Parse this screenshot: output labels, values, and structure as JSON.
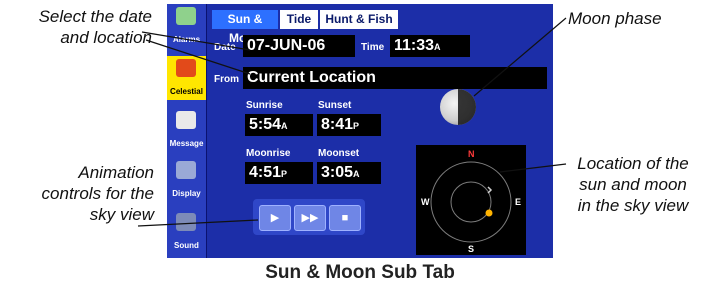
{
  "callouts": {
    "select_date_location_line1": "Select the date",
    "select_date_location_line2": "and location",
    "moon_phase": "Moon phase",
    "animation_line1": "Animation",
    "animation_line2": "controls for the",
    "animation_line3": "sky view",
    "location_line1": "Location of the",
    "location_line2": "sun and moon",
    "location_line3": "in the sky view"
  },
  "caption": "Sun & Moon Sub Tab",
  "sidebar": {
    "items": [
      {
        "label": "Alarms",
        "icon": "alarm-clock-icon"
      },
      {
        "label": "Celestial",
        "icon": "celestial-icon",
        "active": true
      },
      {
        "label": "Message",
        "icon": "message-icon"
      },
      {
        "label": "Display",
        "icon": "display-icon"
      },
      {
        "label": "Sound",
        "icon": "sound-icon"
      }
    ]
  },
  "tabs": [
    {
      "label": "Sun & Moon",
      "active": true
    },
    {
      "label": "Tide"
    },
    {
      "label": "Hunt & Fish"
    }
  ],
  "date": {
    "label": "Date",
    "value": "07-JUN-06"
  },
  "time": {
    "label": "Time",
    "value": "11:33",
    "suffix": "A"
  },
  "from": {
    "label": "From",
    "value": "Current Location"
  },
  "sunrise": {
    "label": "Sunrise",
    "value": "5:54",
    "suffix": "A"
  },
  "sunset": {
    "label": "Sunset",
    "value": "8:41",
    "suffix": "P"
  },
  "moonrise": {
    "label": "Moonrise",
    "value": "4:51",
    "suffix": "P"
  },
  "moonset": {
    "label": "Moonset",
    "value": "3:05",
    "suffix": "A"
  },
  "sky_view": {
    "north": "N",
    "south": "S",
    "east": "E",
    "west": "W"
  },
  "controls": {
    "play": "play-icon",
    "fast_forward": "fast-forward-icon",
    "stop": "stop-icon"
  },
  "colors": {
    "screen_bg": "#1c2ea8",
    "active_tab": "#2d70ff",
    "active_sidebar": "#ffe600",
    "sun": "#ffb300"
  }
}
